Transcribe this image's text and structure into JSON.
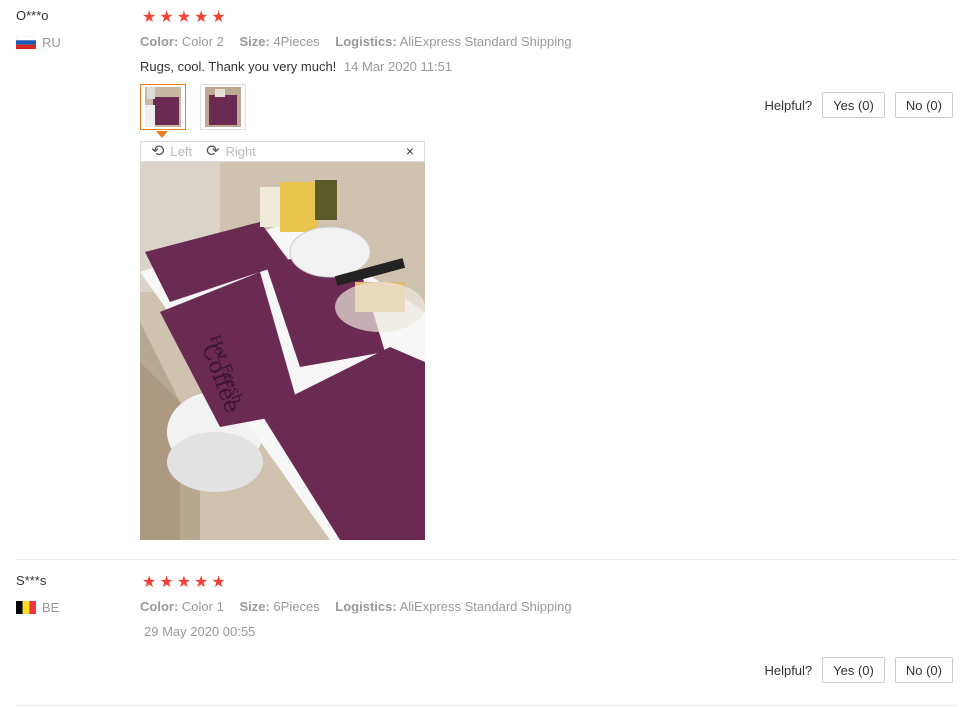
{
  "reviews": [
    {
      "user": "O***o",
      "country": "RU",
      "stars": 5,
      "attrs": {
        "color_key": "Color:",
        "color_val": "Color 2",
        "size_key": "Size:",
        "size_val": "4Pieces",
        "logistics_key": "Logistics:",
        "logistics_val": "AliExpress Standard Shipping"
      },
      "text": "Rugs, cool. Thank you very much!",
      "date": "14 Mar 2020 11:51",
      "helpful_label": "Helpful?",
      "yes_label": "Yes (0)",
      "no_label": "No (0)",
      "viewer": {
        "left_label": "Left",
        "right_label": "Right",
        "close": "×"
      },
      "photo_text_1": "Hot Fresh",
      "photo_text_2": "Coffee"
    },
    {
      "user": "S***s",
      "country": "BE",
      "stars": 5,
      "attrs": {
        "color_key": "Color:",
        "color_val": "Color 1",
        "size_key": "Size:",
        "size_val": "6Pieces",
        "logistics_key": "Logistics:",
        "logistics_val": "AliExpress Standard Shipping"
      },
      "text": "",
      "date": "29 May 2020 00:55",
      "helpful_label": "Helpful?",
      "yes_label": "Yes (0)",
      "no_label": "No (0)"
    }
  ],
  "icons": {
    "star": "★",
    "rotate_left": "⟲",
    "rotate_right": "⟳"
  },
  "colors": {
    "star": "#f44336",
    "active_thumb": "#e67e22",
    "mat": "#6a2a52"
  }
}
